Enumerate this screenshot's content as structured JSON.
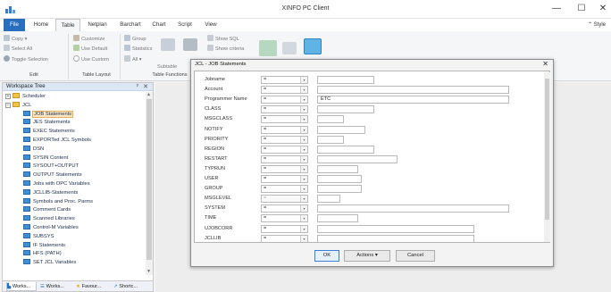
{
  "window": {
    "title": "XINFO PC Client",
    "minimize": "—",
    "maximize": "☐",
    "close": "✕"
  },
  "ribbon_tabs": [
    "File",
    "Home",
    "Table",
    "Netplan",
    "Barchart",
    "Chart",
    "Script",
    "View"
  ],
  "active_tab": "Table",
  "style_button": "Style",
  "ribbon": {
    "edit": {
      "copy": "Copy",
      "select_all": "Select All",
      "toggle_selection": "Toggle Selection",
      "label": "Edit"
    },
    "table_layout": {
      "customize": "Customize",
      "use_default": "Use Default",
      "use_custom": "Use Custom",
      "label": "Table Layout"
    },
    "table_functions": {
      "group": "Group",
      "statistics": "Statistics",
      "all": "All",
      "subtable": "Subtable",
      "show_sql": "Show SQL",
      "show_criteria": "Show criteria",
      "label": "Table Functions"
    }
  },
  "workspace": {
    "title": "Workspace Tree",
    "pin": "ᵖ",
    "close": "✕",
    "tree": [
      {
        "label": "Scheduler",
        "level": 0,
        "icon": "folder-icon",
        "expander": "+"
      },
      {
        "label": "JCL",
        "level": 0,
        "icon": "folder-icon",
        "expander": "−"
      },
      {
        "label": "JOB Statements",
        "level": 1,
        "icon": "table-icon",
        "selected": true
      },
      {
        "label": "JES Statements",
        "level": 1,
        "icon": "table-icon"
      },
      {
        "label": "EXEC Statements",
        "level": 1,
        "icon": "table-icon"
      },
      {
        "label": "EXPORTed JCL Symbols",
        "level": 1,
        "icon": "table-icon"
      },
      {
        "label": "DSN",
        "level": 1,
        "icon": "table-icon"
      },
      {
        "label": "SYSIN Content",
        "level": 1,
        "icon": "table-icon"
      },
      {
        "label": "SYSOUT+OUTPUT",
        "level": 1,
        "icon": "table-icon"
      },
      {
        "label": "OUTPUT Statements",
        "level": 1,
        "icon": "table-icon"
      },
      {
        "label": "Jobs with OPC Variables",
        "level": 1,
        "icon": "table-icon"
      },
      {
        "label": "JCLLIB-Statements",
        "level": 1,
        "icon": "table-icon"
      },
      {
        "label": "Symbols and Proc. Parms",
        "level": 1,
        "icon": "table-icon"
      },
      {
        "label": "Comment Cards",
        "level": 1,
        "icon": "table-icon"
      },
      {
        "label": "Scanned Libraries",
        "level": 1,
        "icon": "table-icon"
      },
      {
        "label": "Control-M Variables",
        "level": 1,
        "icon": "table-icon"
      },
      {
        "label": "SUBSYS",
        "level": 1,
        "icon": "table-icon"
      },
      {
        "label": "IF Statements",
        "level": 1,
        "icon": "table-icon"
      },
      {
        "label": "HFS (PATH)",
        "level": 1,
        "icon": "table-icon"
      },
      {
        "label": "SET JCL Variables",
        "level": 1,
        "icon": "table-icon"
      }
    ],
    "bottom_tabs": [
      "Works...",
      "Works...",
      "Favour...",
      "Shortc..."
    ]
  },
  "dialog": {
    "title": "JCL - JOB Statements",
    "close": "✕",
    "fields": [
      {
        "label": "Jobname",
        "op": "=",
        "value": ""
      },
      {
        "label": "Account",
        "op": "=",
        "value": ""
      },
      {
        "label": "Programmer Name",
        "op": "=",
        "value": "ETC"
      },
      {
        "label": "CLASS",
        "op": "=",
        "value": ""
      },
      {
        "label": "MSGCLASS",
        "op": "=",
        "value": ""
      },
      {
        "label": "NOTIFY",
        "op": "=",
        "value": ""
      },
      {
        "label": "PRIORITY",
        "op": "=",
        "value": ""
      },
      {
        "label": "REGION",
        "op": "=",
        "value": ""
      },
      {
        "label": "RESTART",
        "op": "=",
        "value": ""
      },
      {
        "label": "TYPRUN",
        "op": "=",
        "value": ""
      },
      {
        "label": "USER",
        "op": "=",
        "value": ""
      },
      {
        "label": "GROUP",
        "op": "=",
        "value": ""
      },
      {
        "label": "MSGLEVEL",
        "op": "=",
        "value": ""
      },
      {
        "label": "SYSTEM",
        "op": "=",
        "value": ""
      },
      {
        "label": "TIME",
        "op": "=",
        "value": ""
      },
      {
        "label": "UJOBCORR",
        "op": "=",
        "value": ""
      },
      {
        "label": "JCLLIB",
        "op": "=",
        "value": ""
      }
    ],
    "buttons": {
      "ok": "OK",
      "actions": "Actions",
      "cancel": "Cancel"
    }
  },
  "colors": {
    "file_tab": "#2a6ebf",
    "accent": "#3f8fd6",
    "folder": "#f1c54c",
    "selected": "#fbe7c5"
  }
}
